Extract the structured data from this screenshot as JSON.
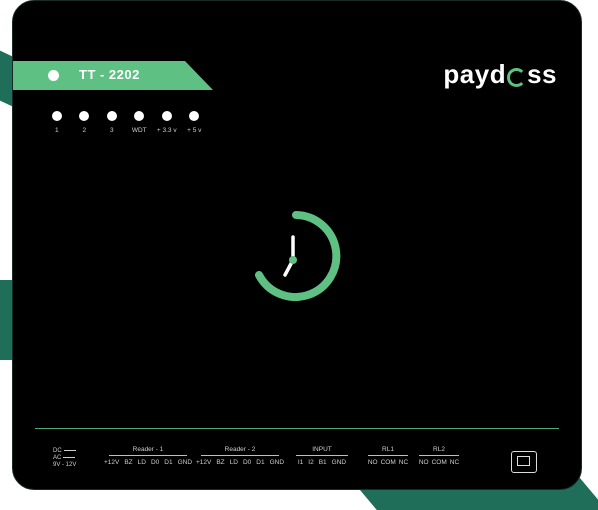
{
  "device": {
    "model": "TT - 2202",
    "brand": "paydoss",
    "brand_prefix": "payd",
    "brand_suffix": "ss",
    "accent_color": "#5ec083"
  },
  "leds": [
    {
      "label": "1"
    },
    {
      "label": "2"
    },
    {
      "label": "3"
    },
    {
      "label": "WDT"
    },
    {
      "label": "+ 3.3 v"
    },
    {
      "label": "+ 5 v"
    }
  ],
  "status_icon": "clock-loading-icon",
  "power": {
    "line1": "DC",
    "line2": "AC",
    "line3": "9V - 12V"
  },
  "terminals": [
    {
      "title": "Reader - 1",
      "pins": [
        "+12V",
        "BZ",
        "LD",
        "D0",
        "D1",
        "GND"
      ]
    },
    {
      "title": "Reader - 2",
      "pins": [
        "+12V",
        "BZ",
        "LD",
        "D0",
        "D1",
        "GND"
      ]
    },
    {
      "title": "INPUT",
      "pins": [
        "I1",
        "I2",
        "B1",
        "GND"
      ]
    },
    {
      "title": "RL1",
      "pins": [
        "NO",
        "COM",
        "NC"
      ]
    },
    {
      "title": "RL2",
      "pins": [
        "NO",
        "COM",
        "NC"
      ]
    }
  ],
  "ethernet_icon": "ethernet-port-icon"
}
